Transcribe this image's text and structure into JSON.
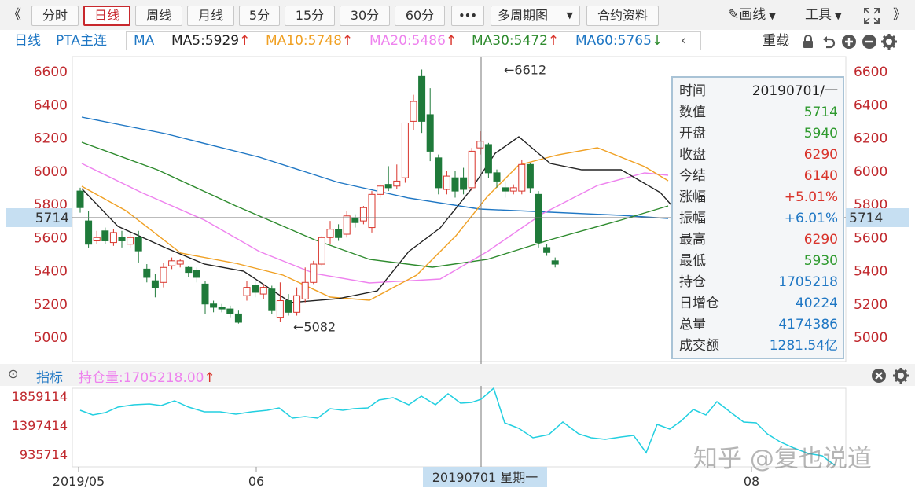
{
  "toolbar": {
    "collapse_left": "《",
    "tabs": [
      "分时",
      "日线",
      "周线",
      "月线",
      "5分",
      "15分",
      "30分",
      "60分"
    ],
    "active_tab": "日线",
    "more": "•••",
    "multi_period": "多周期图",
    "contract_info": "合约资料",
    "draw_line": "画线",
    "tools": "工具",
    "collapse_right": "》"
  },
  "ma_row": {
    "period": "日线",
    "symbol": "PTA主连",
    "ma_label": "MA",
    "ma5": "MA5:5929",
    "ma10": "MA10:5748",
    "ma20": "MA20:5486",
    "ma30": "MA30:5472",
    "ma60": "MA60:5765",
    "reload": "重载",
    "colors": {
      "ma5": "#222222",
      "ma10": "#f0a023",
      "ma20": "#ee82ee",
      "ma30": "#2e8b2e",
      "ma60": "#1f77c4"
    }
  },
  "main_chart": {
    "price_ticks": [
      "6600",
      "6400",
      "6200",
      "6000",
      "5800",
      "5600",
      "5400",
      "5200",
      "5000"
    ],
    "crosshair_price": "5714",
    "high_marker": "←6612",
    "low_marker": "←5082"
  },
  "info_panel": {
    "rows": [
      {
        "label": "时间",
        "value": "20190701/一",
        "color": "#222222"
      },
      {
        "label": "数值",
        "value": "5714",
        "color": "#2e9a2e"
      },
      {
        "label": "开盘",
        "value": "5940",
        "color": "#2e9a2e"
      },
      {
        "label": "收盘",
        "value": "6290",
        "color": "#d9342b"
      },
      {
        "label": "今结",
        "value": "6140",
        "color": "#d9342b"
      },
      {
        "label": "涨幅",
        "value": "+5.01%",
        "color": "#d9342b"
      },
      {
        "label": "振幅",
        "value": "+6.01%",
        "color": "#1f77c4"
      },
      {
        "label": "最高",
        "value": "6290",
        "color": "#d9342b"
      },
      {
        "label": "最低",
        "value": "5930",
        "color": "#2e9a2e"
      },
      {
        "label": "持仓",
        "value": "1705218",
        "color": "#1f77c4"
      },
      {
        "label": "日增仓",
        "value": "40224",
        "color": "#1f77c4"
      },
      {
        "label": "总量",
        "value": "4174386",
        "color": "#1f77c4"
      },
      {
        "label": "成交额",
        "value": "1281.54亿",
        "color": "#1f77c4"
      }
    ]
  },
  "indicator": {
    "label": "指标",
    "open_interest": "持仓量:1705218.00",
    "ticks": [
      "1859114",
      "1397414",
      "935714"
    ]
  },
  "x_axis": {
    "labels": [
      "2019/05",
      "06",
      "08"
    ],
    "crosshair_label": "20190701 星期一"
  },
  "watermark": "知乎 @复也说道"
}
